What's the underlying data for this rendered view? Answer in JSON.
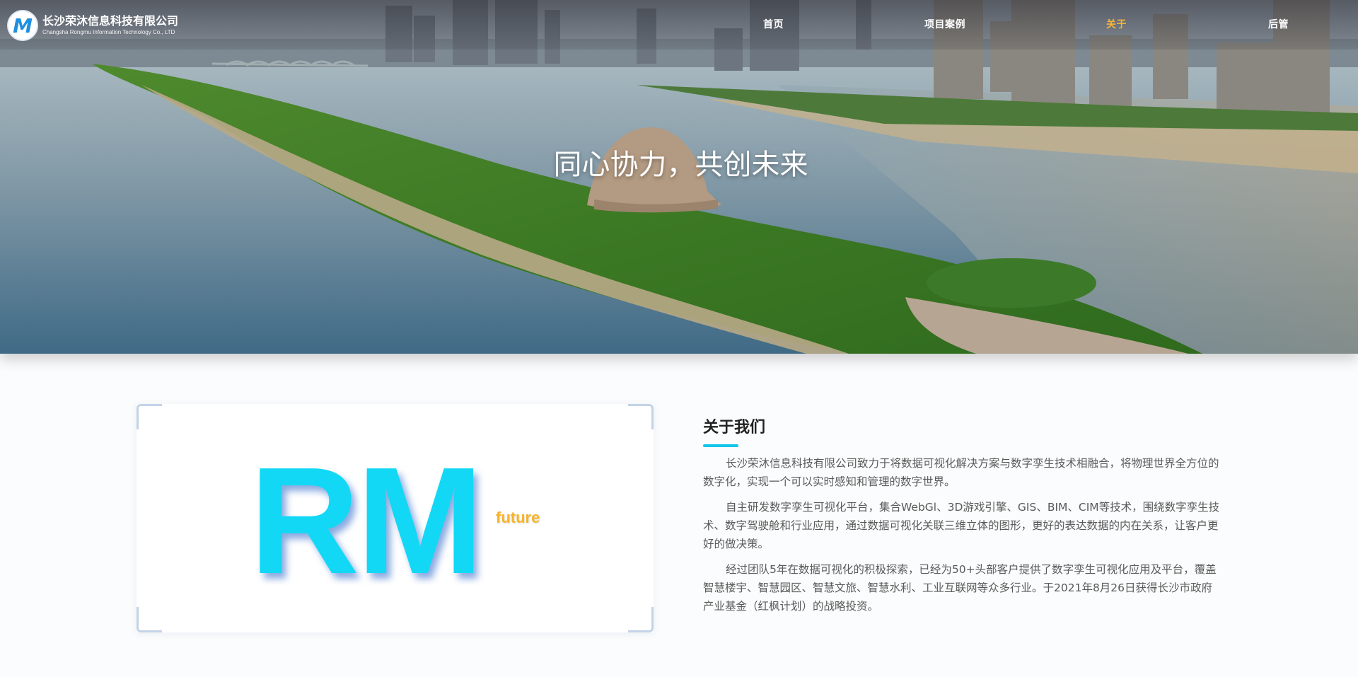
{
  "company": {
    "name_cn": "长沙荣沐信息科技有限公司",
    "name_en": "Changsha Rongmu Information Technology Co., LTD",
    "logo_mark": "M"
  },
  "nav": {
    "items": [
      {
        "label": "首页"
      },
      {
        "label": "项目案例"
      },
      {
        "label": "关于"
      },
      {
        "label": "后管"
      }
    ],
    "active_index": 2,
    "active_color": "#f5b43a"
  },
  "hero": {
    "slogan": "同心协力，共创未来"
  },
  "about": {
    "logo_text": "RM",
    "logo_sub": "future",
    "title": "关于我们",
    "paragraphs": [
      "长沙荣沐信息科技有限公司致力于将数据可视化解决方案与数字孪生技术相融合，将物理世界全方位的数字化，实现一个可以实时感知和管理的数字世界。",
      "自主研发数字孪生可视化平台，集合WebGl、3D游戏引擎、GIS、BIM、CIM等技术，围绕数字孪生技术、数字驾驶舱和行业应用，通过数据可视化关联三维立体的图形，更好的表达数据的内在关系，让客户更好的做决策。",
      "经过团队5年在数据可视化的积极探索，已经为50+头部客户提供了数字孪生可视化应用及平台，覆盖智慧楼宇、智慧园区、智慧文旅、智慧水利、工业互联网等众多行业。于2021年8月26日获得长沙市政府产业基金（红枫计划）的战略投资。"
    ],
    "accent_color": "#12c6e8",
    "logo_color": "#12d8f5"
  }
}
